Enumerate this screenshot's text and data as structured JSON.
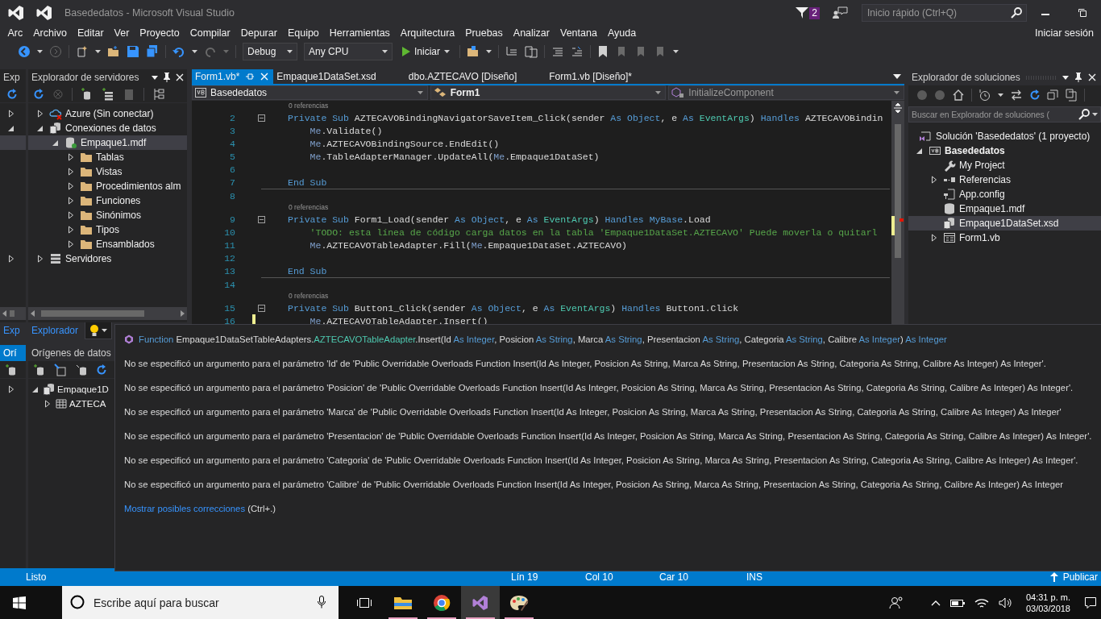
{
  "window": {
    "title": "Basededatos - Microsoft Visual Studio",
    "notifications": "2",
    "quick_launch": {
      "placeholder": "Inicio rápido (Ctrl+Q)"
    }
  },
  "menu": {
    "items": [
      "Arc",
      "Archivo",
      "Editar",
      "Ver",
      "Proyecto",
      "Compilar",
      "Depurar",
      "Equipo",
      "Herramientas",
      "Arquitectura",
      "Pruebas",
      "Analizar",
      "Ventana",
      "Ayuda"
    ],
    "sign_in": "Iniciar sesión"
  },
  "toolbar": {
    "configuration": "Debug",
    "platform": "Any CPU",
    "start": "Iniciar"
  },
  "left_strip": {
    "title": "Exp",
    "rows": [
      {
        "expanded": false,
        "selected": false
      },
      {
        "expanded": true,
        "selected": false
      },
      {
        "selected": true
      }
    ],
    "last_row": {
      "expanded": false,
      "selected": false
    },
    "tab": {
      "label": "Exp",
      "selected": true
    },
    "lower_title": "Orí",
    "lower_rows": [
      {
        "expanded": false,
        "selected": false
      }
    ]
  },
  "server_explorer": {
    "title": "Explorador de servidores",
    "tree": [
      {
        "label": "Azure (Sin conectar)",
        "kind": "cloud",
        "expanded": false,
        "selected": false
      },
      {
        "label": "Conexiones de datos",
        "kind": "connections",
        "expanded": true,
        "selected": false,
        "children": [
          {
            "label": "Empaque1.mdf",
            "kind": "database",
            "expanded": true,
            "selected": true,
            "children": [
              {
                "label": "Tablas",
                "kind": "folder",
                "expanded": false,
                "selected": false
              },
              {
                "label": "Vistas",
                "kind": "folder",
                "expanded": false,
                "selected": false
              },
              {
                "label": "Procedimientos alm",
                "kind": "folder",
                "expanded": false,
                "selected": false
              },
              {
                "label": "Funciones",
                "kind": "folder",
                "expanded": false,
                "selected": false
              },
              {
                "label": "Sinónimos",
                "kind": "folder",
                "expanded": false,
                "selected": false
              },
              {
                "label": "Tipos",
                "kind": "folder",
                "expanded": false,
                "selected": false
              },
              {
                "label": "Ensamblados",
                "kind": "folder",
                "expanded": false,
                "selected": false
              }
            ]
          }
        ]
      },
      {
        "label": "Servidores",
        "kind": "server",
        "expanded": false,
        "selected": false
      }
    ]
  },
  "data_sources": {
    "tab": {
      "label": "Explorador",
      "selected": true
    },
    "title": "Orígenes de datos",
    "tree": [
      {
        "label": "Empaque1D",
        "kind": "connections",
        "expanded": true,
        "selected": false,
        "children": [
          {
            "label": "AZTECA",
            "kind": "table",
            "expanded": false,
            "selected": false
          }
        ]
      }
    ]
  },
  "editor": {
    "tabs": [
      {
        "label": "Form1.vb*",
        "selected": true
      },
      {
        "label": "Empaque1DataSet.xsd",
        "selected": false
      },
      {
        "label": "dbo.AZTECAVO [Diseño]",
        "selected": false
      },
      {
        "label": "Form1.vb [Diseño]*",
        "selected": false
      }
    ],
    "navigation": {
      "project": "Basededatos",
      "type": "Form1",
      "member": "InitializeComponent"
    },
    "lines": [
      {
        "kind": "lens",
        "text": "0 referencias"
      },
      {
        "kind": "code",
        "number": "2",
        "foldable": true,
        "modified": false,
        "indented": false,
        "segments": [
          {
            "kind": "kw",
            "text": "Private Sub "
          },
          {
            "kind": "plain",
            "text": "AZTECAVOBindingNavigatorSaveItem_Click(sender "
          },
          {
            "kind": "kw",
            "text": "As Object"
          },
          {
            "kind": "plain",
            "text": ", e "
          },
          {
            "kind": "kw",
            "text": "As "
          },
          {
            "kind": "type",
            "text": "EventArgs"
          },
          {
            "kind": "plain",
            "text": ") "
          },
          {
            "kind": "kw",
            "text": "Handles "
          },
          {
            "kind": "plain",
            "text": "AZTECAVOBindin"
          }
        ]
      },
      {
        "kind": "code",
        "number": "3",
        "foldable": false,
        "modified": false,
        "indented": true,
        "segments": [
          {
            "kind": "me",
            "text": "Me"
          },
          {
            "kind": "plain",
            "text": ".Validate()"
          }
        ]
      },
      {
        "kind": "code",
        "number": "4",
        "foldable": false,
        "modified": false,
        "indented": true,
        "segments": [
          {
            "kind": "me",
            "text": "Me"
          },
          {
            "kind": "plain",
            "text": ".AZTECAVOBindingSource.EndEdit()"
          }
        ]
      },
      {
        "kind": "code",
        "number": "5",
        "foldable": false,
        "modified": false,
        "indented": true,
        "segments": [
          {
            "kind": "me",
            "text": "Me"
          },
          {
            "kind": "plain",
            "text": ".TableAdapterManager.UpdateAll("
          },
          {
            "kind": "me",
            "text": "Me"
          },
          {
            "kind": "plain",
            "text": ".Empaque1DataSet)"
          }
        ]
      },
      {
        "kind": "code",
        "number": "6",
        "foldable": false,
        "modified": false
      },
      {
        "kind": "code",
        "number": "7",
        "foldable": false,
        "modified": false,
        "indented": false,
        "segments": [
          {
            "kind": "kw",
            "text": "End Sub"
          }
        ]
      },
      {
        "kind": "separator"
      },
      {
        "kind": "code",
        "number": "8",
        "foldable": false,
        "modified": false
      },
      {
        "kind": "lens",
        "text": "0 referencias"
      },
      {
        "kind": "code",
        "number": "9",
        "foldable": true,
        "modified": false,
        "indented": false,
        "segments": [
          {
            "kind": "kw",
            "text": "Private Sub "
          },
          {
            "kind": "plain",
            "text": "Form1_Load(sender "
          },
          {
            "kind": "kw",
            "text": "As Object"
          },
          {
            "kind": "plain",
            "text": ", e "
          },
          {
            "kind": "kw",
            "text": "As "
          },
          {
            "kind": "type",
            "text": "EventArgs"
          },
          {
            "kind": "plain",
            "text": ") "
          },
          {
            "kind": "kw",
            "text": "Handles MyBase"
          },
          {
            "kind": "plain",
            "text": ".Load"
          }
        ]
      },
      {
        "kind": "code",
        "number": "10",
        "foldable": false,
        "modified": false,
        "indented": true,
        "segments": [
          {
            "kind": "comment",
            "text": "'TODO: esta línea de código carga datos en la tabla 'Empaque1DataSet.AZTECAVO' Puede moverla o quitarl"
          }
        ]
      },
      {
        "kind": "code",
        "number": "11",
        "foldable": false,
        "modified": false,
        "indented": true,
        "segments": [
          {
            "kind": "me",
            "text": "Me"
          },
          {
            "kind": "plain",
            "text": ".AZTECAVOTableAdapter.Fill("
          },
          {
            "kind": "me",
            "text": "Me"
          },
          {
            "kind": "plain",
            "text": ".Empaque1DataSet.AZTECAVO)"
          }
        ]
      },
      {
        "kind": "code",
        "number": "12",
        "foldable": false,
        "modified": false
      },
      {
        "kind": "code",
        "number": "13",
        "foldable": false,
        "modified": false,
        "indented": false,
        "segments": [
          {
            "kind": "kw",
            "text": "End Sub"
          }
        ]
      },
      {
        "kind": "separator"
      },
      {
        "kind": "code",
        "number": "14",
        "foldable": false,
        "modified": false
      },
      {
        "kind": "lens",
        "text": "0 referencias"
      },
      {
        "kind": "code",
        "number": "15",
        "foldable": true,
        "modified": false,
        "indented": false,
        "segments": [
          {
            "kind": "kw",
            "text": "Private Sub "
          },
          {
            "kind": "plain",
            "text": "Button1_Click(sender "
          },
          {
            "kind": "kw",
            "text": "As Object"
          },
          {
            "kind": "plain",
            "text": ", e "
          },
          {
            "kind": "kw",
            "text": "As "
          },
          {
            "kind": "type",
            "text": "EventArgs"
          },
          {
            "kind": "plain",
            "text": ") "
          },
          {
            "kind": "kw",
            "text": "Handles "
          },
          {
            "kind": "plain",
            "text": "Button1.Click"
          }
        ]
      },
      {
        "kind": "code",
        "number": "16",
        "foldable": false,
        "modified": true,
        "indented": true,
        "segments": [
          {
            "kind": "me",
            "text": "Me"
          },
          {
            "kind": "plain",
            "text": ".AZTECAVOTableAdapter."
          },
          {
            "kind": "error",
            "text": "Insert"
          },
          {
            "kind": "plain",
            "text": "()"
          }
        ]
      }
    ]
  },
  "tooltip": {
    "signature": [
      {
        "kind": "kw",
        "text": "Function"
      },
      {
        "kind": "plain",
        "text": " Empaque1DataSetTableAdapters."
      },
      {
        "kind": "type",
        "text": "AZTECAVOTableAdapter"
      },
      {
        "kind": "plain",
        "text": ".Insert(Id "
      },
      {
        "kind": "kw",
        "text": "As Integer"
      },
      {
        "kind": "plain",
        "text": ", Posicion "
      },
      {
        "kind": "kw",
        "text": "As String"
      },
      {
        "kind": "plain",
        "text": ", Marca "
      },
      {
        "kind": "kw",
        "text": "As String"
      },
      {
        "kind": "plain",
        "text": ", Presentacion "
      },
      {
        "kind": "kw",
        "text": "As String"
      },
      {
        "kind": "plain",
        "text": ", Categoria "
      },
      {
        "kind": "kw",
        "text": "As String"
      },
      {
        "kind": "plain",
        "text": ", Calibre "
      },
      {
        "kind": "kw",
        "text": "As Integer"
      },
      {
        "kind": "plain",
        "text": ") "
      },
      {
        "kind": "kw",
        "text": "As Integer"
      }
    ],
    "messages": [
      "No se especificó un argumento para el parámetro 'Id' de 'Public Overridable Overloads Function Insert(Id As Integer, Posicion As String, Marca As String, Presentacion As String, Categoria As String, Calibre As Integer) As Integer'.",
      "No se especificó un argumento para el parámetro 'Posicion' de 'Public Overridable Overloads Function Insert(Id As Integer, Posicion As String, Marca As String, Presentacion As String, Categoria As String, Calibre As Integer) As Integer'.",
      "No se especificó un argumento para el parámetro 'Marca' de 'Public Overridable Overloads Function Insert(Id As Integer, Posicion As String, Marca As String, Presentacion As String, Categoria As String, Calibre As Integer) As Integer'",
      "No se especificó un argumento para el parámetro 'Presentacion' de 'Public Overridable Overloads Function Insert(Id As Integer, Posicion As String, Marca As String, Presentacion As String, Categoria As String, Calibre As Integer) As Integer'.",
      "No se especificó un argumento para el parámetro 'Categoria' de 'Public Overridable Overloads Function Insert(Id As Integer, Posicion As String, Marca As String, Presentacion As String, Categoria As String, Calibre As Integer) As Integer'.",
      "No se especificó un argumento para el parámetro 'Calibre' de 'Public Overridable Overloads Function Insert(Id As Integer, Posicion As String, Marca As String, Presentacion As String, Categoria As String, Calibre As Integer) As Integer"
    ],
    "fix_link": "Mostrar posibles correcciones",
    "fix_shortcut": "(Ctrl+.)"
  },
  "solution_explorer": {
    "title": "Explorador de soluciones",
    "search": {
      "placeholder": "Buscar en Explorador de soluciones ("
    },
    "solution": {
      "label": "Solución 'Basededatos'  (1 proyecto)",
      "selected": false
    },
    "tree": [
      {
        "label": "Basededatos",
        "kind": "vb-project",
        "expanded": true,
        "selected": false,
        "children": [
          {
            "label": "My Project",
            "kind": "wrench",
            "selected": false
          },
          {
            "label": "Referencias",
            "kind": "references",
            "expanded": false,
            "selected": false
          },
          {
            "label": "App.config",
            "kind": "config",
            "selected": false
          },
          {
            "label": "Empaque1.mdf",
            "kind": "database-file",
            "selected": false
          },
          {
            "label": "Empaque1DataSet.xsd",
            "kind": "connections",
            "selected": true
          },
          {
            "label": "Form1.vb",
            "kind": "form",
            "expanded": false,
            "selected": false
          }
        ]
      }
    ]
  },
  "status_bar": {
    "message": "Listo",
    "line": "Lín 19",
    "column": "Col 10",
    "char": "Car 10",
    "mode": "INS",
    "publish": "Publicar"
  },
  "taskbar": {
    "search": {
      "placeholder": "Escribe aquí para buscar"
    },
    "apps": [
      {
        "kind": "explorer",
        "running": true,
        "selected": false
      },
      {
        "kind": "browser",
        "running": true,
        "selected": false
      },
      {
        "kind": "vs",
        "running": true,
        "selected": true
      },
      {
        "kind": "paint",
        "running": true,
        "selected": false
      }
    ],
    "time": "04:31 p. m.",
    "date": "03/03/2018"
  }
}
